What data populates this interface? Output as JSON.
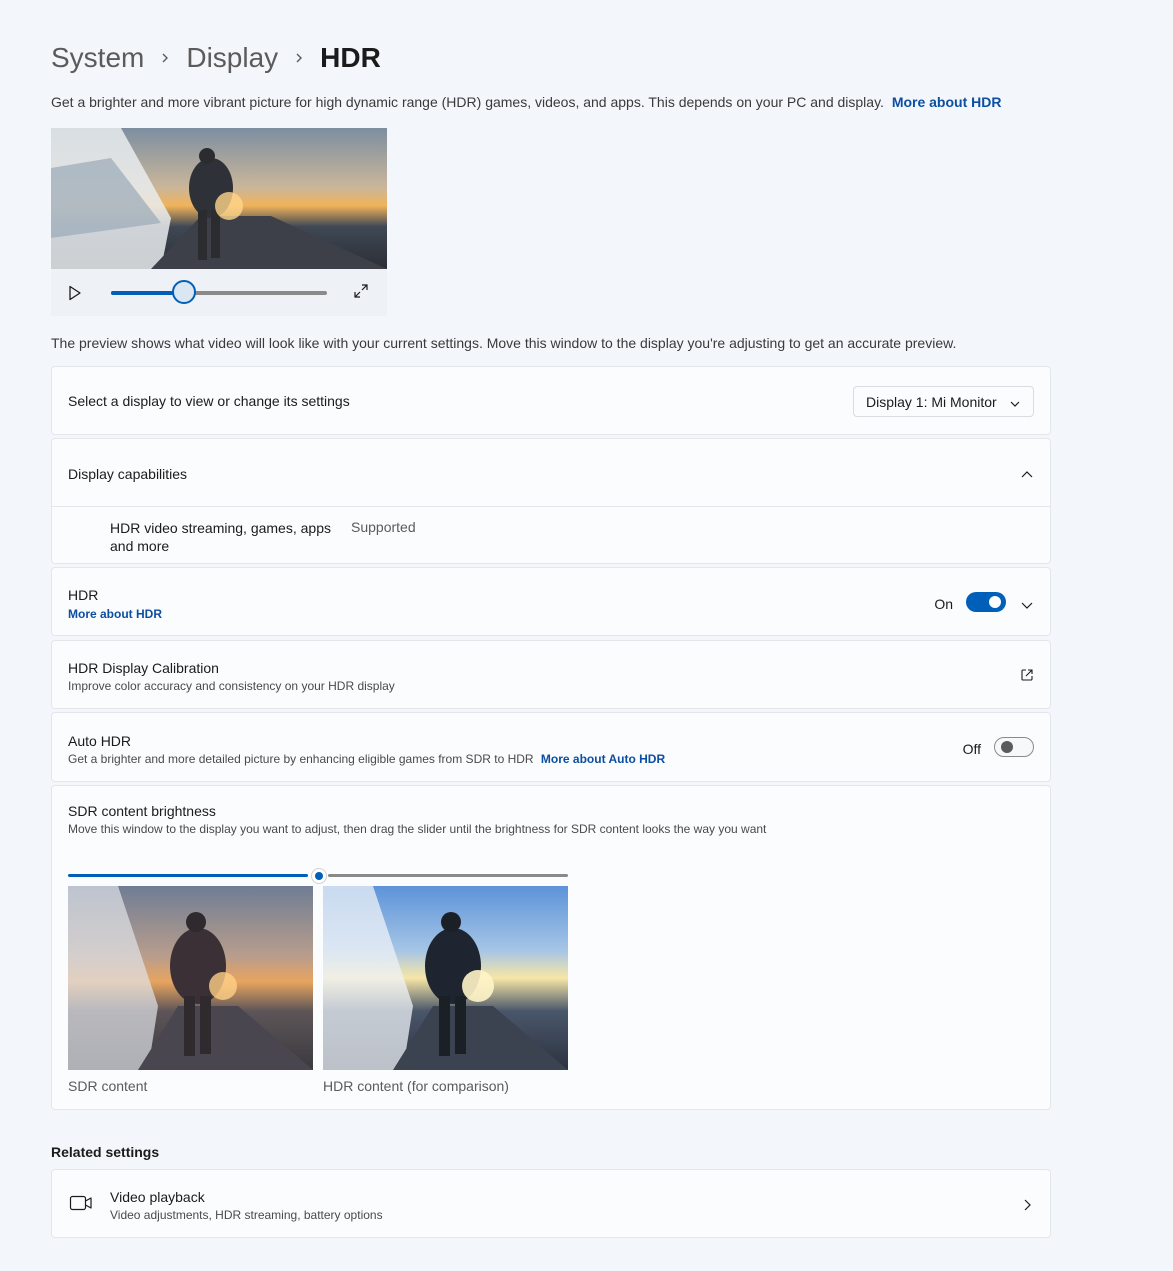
{
  "breadcrumb": {
    "items": [
      "System",
      "Display",
      "HDR"
    ]
  },
  "intro": {
    "text": "Get a brighter and more vibrant picture for high dynamic range (HDR) games, videos, and apps. This depends on your PC and display.",
    "link": "More about HDR"
  },
  "video_preview": {
    "progress": 0.34
  },
  "preview_note": "The preview shows what video will look like with your current settings. Move this window to the display you're adjusting to get an accurate preview.",
  "display_select": {
    "label": "Select a display to view or change its settings",
    "value": "Display 1: Mi Monitor"
  },
  "capabilities": {
    "title": "Display capabilities",
    "items": [
      {
        "name_line1": "HDR video streaming, games, apps",
        "name_line2": "and more",
        "status": "Supported"
      }
    ]
  },
  "hdr": {
    "title": "HDR",
    "link": "More about HDR",
    "state_label": "On",
    "on": true
  },
  "calibration": {
    "title": "HDR Display Calibration",
    "subtitle": "Improve color accuracy and consistency on your HDR display"
  },
  "auto_hdr": {
    "title": "Auto HDR",
    "subtitle": "Get a brighter and more detailed picture by enhancing eligible games from SDR to HDR",
    "link": "More about Auto HDR",
    "state_label": "Off",
    "on": false
  },
  "sdr_brightness": {
    "title": "SDR content brightness",
    "subtitle": "Move this window to the display you want to adjust, then drag the slider until the brightness for SDR content looks the way you want",
    "value_fraction": 0.5,
    "sdr_caption": "SDR content",
    "hdr_caption": "HDR content (for comparison)"
  },
  "related": {
    "title": "Related settings",
    "video_playback": {
      "title": "Video playback",
      "subtitle": "Video adjustments, HDR streaming, battery options"
    }
  },
  "colors": {
    "accent": "#005fb8",
    "link": "#0b4ea2"
  }
}
